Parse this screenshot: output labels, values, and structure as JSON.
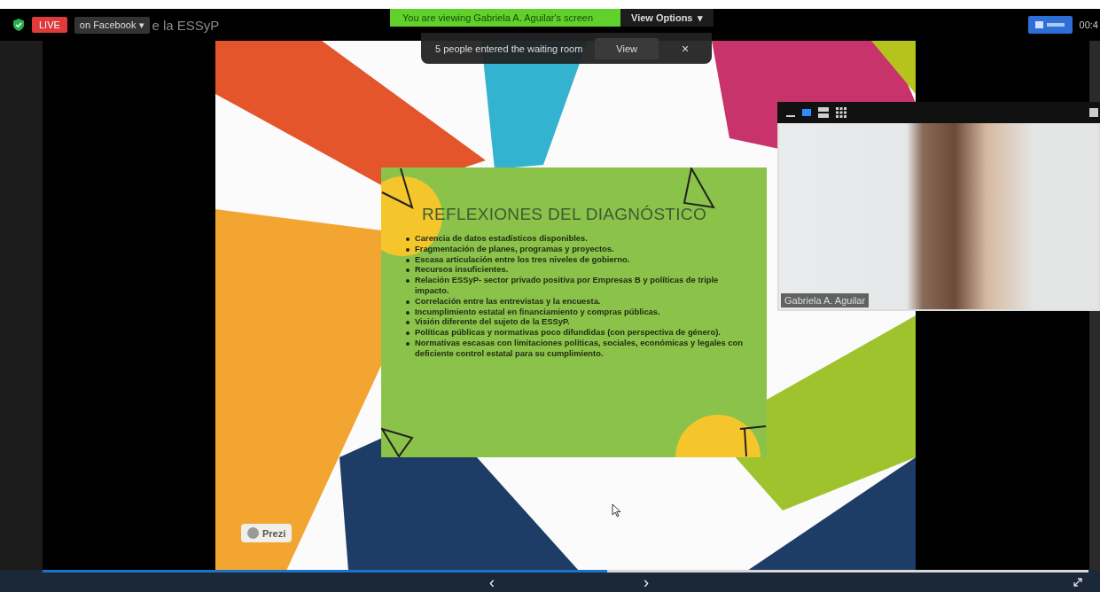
{
  "top_bar": {
    "live_badge": "LIVE",
    "stream_menu": {
      "label": "on Facebook",
      "caret": "▾"
    },
    "meeting_title": "e la ESSyP",
    "timer": "00:4"
  },
  "sharing_banner": {
    "text": "You are viewing Gabriela A. Aguilar's screen",
    "view_options": {
      "label": "View Options",
      "caret": "▾"
    }
  },
  "notification": {
    "text": "5 people entered the waiting room",
    "button": "View",
    "close": "×"
  },
  "slide": {
    "title": "REFLEXIONES DEL DIAGNÓSTICO",
    "bullets": [
      "Carencia de datos estadísticos disponibles.",
      "Fragmentación de planes, programas y proyectos.",
      "Escasa articulación entre los tres niveles de gobierno.",
      "Recursos insuficientes.",
      "Relación ESSyP- sector privado positiva por Empresas B y políticas de triple impacto.",
      "Correlación entre las entrevistas y la encuesta.",
      "Incumplimiento estatal en financiamiento y compras públicas.",
      "Visión diferente del sujeto de la ESSyP.",
      "Políticas públicas y normativas poco difundidas (con perspectiva de género).",
      "Normativas escasas con limitaciones políticas, sociales, económicas y legales con deficiente control estatal para su cumplimiento."
    ],
    "badge": "Prezi"
  },
  "video": {
    "view_modes": [
      {
        "kind": "minimize",
        "selected": false
      },
      {
        "kind": "speaker",
        "selected": true
      },
      {
        "kind": "strip",
        "selected": false
      },
      {
        "kind": "gallery",
        "selected": false
      }
    ],
    "name": "Gabriela A. Aguilar"
  },
  "presentation_nav": {
    "progress": {
      "level": 0.54
    },
    "previous": "‹",
    "next": "›"
  }
}
